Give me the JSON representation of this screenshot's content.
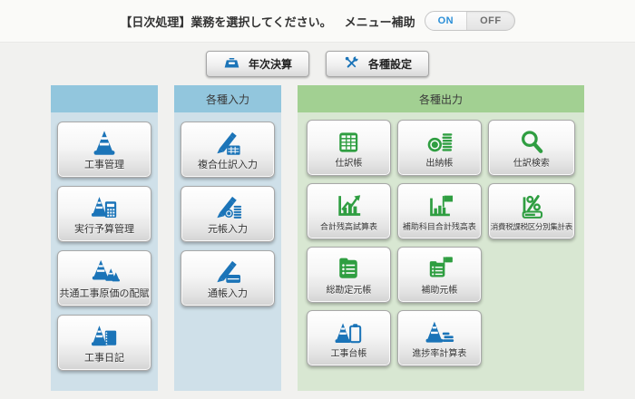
{
  "header": {
    "title": "【日次処理】業務を選択してください。",
    "menu_assist_label": "メニュー補助",
    "toggle": {
      "on": "ON",
      "off": "OFF",
      "active": "ON"
    }
  },
  "actions": [
    {
      "label": "年次決算",
      "icon": "archive-drawer-icon"
    },
    {
      "label": "各種設定",
      "icon": "tools-icon"
    }
  ],
  "panels": {
    "projects": {
      "header_label": "",
      "items": [
        {
          "label": "工事管理",
          "icon": "traffic-cone-icon"
        },
        {
          "label": "実行予算管理",
          "icon": "cone-calculator-icon"
        },
        {
          "label": "共通工事原価の配賦",
          "icon": "multiple-cones-icon"
        },
        {
          "label": "工事日記",
          "icon": "cone-notebook-icon"
        }
      ]
    },
    "input": {
      "header_label": "各種入力",
      "items": [
        {
          "label": "複合仕訳入力",
          "icon": "pencil-table-icon"
        },
        {
          "label": "元帳入力",
          "icon": "pencil-coins-icon"
        },
        {
          "label": "通帳入力",
          "icon": "pencil-passbook-icon"
        }
      ]
    },
    "output": {
      "header_label": "各種出力",
      "items": [
        {
          "label": "仕訳帳",
          "icon": "spreadsheet-icon"
        },
        {
          "label": "出納帳",
          "icon": "coins-stack-icon"
        },
        {
          "label": "仕訳検索",
          "icon": "search-icon"
        },
        {
          "label": "合計残高試算表",
          "icon": "chart-up-arrow-icon"
        },
        {
          "label": "補助科目合計残高表",
          "icon": "chart-flag-icon"
        },
        {
          "label": "消費税課税区分別集計表",
          "icon": "percent-bar-icon"
        },
        {
          "label": "総勘定元帳",
          "icon": "ledger-icon"
        },
        {
          "label": "補助元帳",
          "icon": "ledger-flag-icon"
        },
        {
          "label": "工事台帳",
          "icon": "cone-clipboard-icon"
        },
        {
          "label": "進捗率計算表",
          "icon": "cone-bars-icon"
        }
      ]
    }
  },
  "colors": {
    "icon_blue": "#1b74b8",
    "icon_green": "#2f9e41",
    "panel_blue_header": "#92c6dd",
    "panel_blue_body": "#cfe0e9",
    "panel_green_header": "#a2d092",
    "panel_green_body": "#d8e7d2",
    "toggle_on_text": "#2b8fd8"
  }
}
